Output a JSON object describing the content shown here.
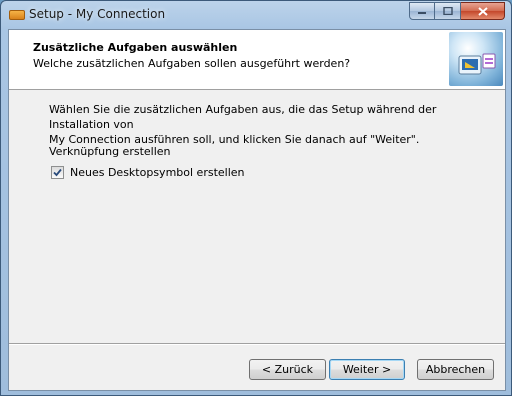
{
  "window": {
    "title": "Setup - My Connection"
  },
  "header": {
    "title": "Zusätzliche Aufgaben auswählen",
    "subtitle": "Welche zusätzlichen Aufgaben sollen ausgeführt werden?"
  },
  "body": {
    "description_line1": "Wählen Sie die zusätzlichen Aufgaben aus, die das Setup während der Installation von",
    "description_line2": "My Connection ausführen soll, und klicken Sie danach auf \"Weiter\".",
    "group_label": "Verknüpfung erstellen",
    "tasks": [
      {
        "label": "Neues Desktopsymbol erstellen",
        "checked": true
      }
    ]
  },
  "buttons": {
    "back": "< Zurück",
    "next": "Weiter >",
    "cancel": "Abbrechen"
  }
}
